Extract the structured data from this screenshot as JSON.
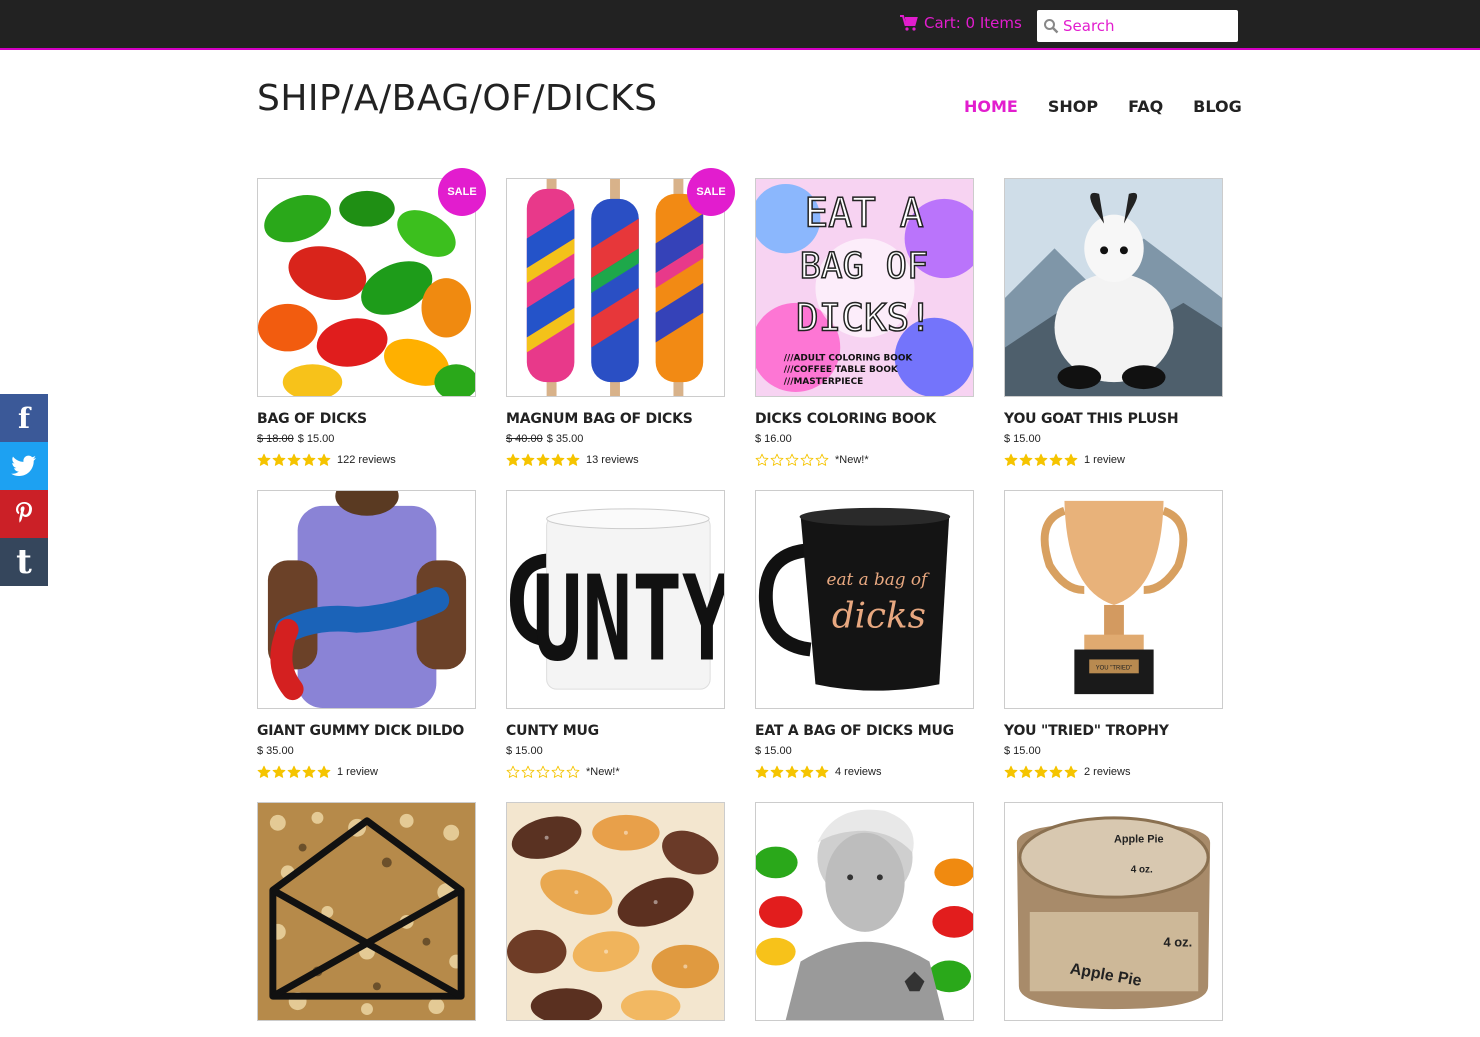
{
  "header": {
    "cart_label": "Cart: 0 Items",
    "search_placeholder": "Search",
    "logo": "SHIP/A/BAG/OF/DICKS",
    "nav": [
      "HOME",
      "SHOP",
      "FAQ",
      "BLOG"
    ],
    "active_nav": "HOME"
  },
  "share": [
    {
      "network": "facebook",
      "icon": "facebook-icon",
      "color": "#3b5998"
    },
    {
      "network": "twitter",
      "icon": "twitter-icon",
      "color": "#1da1f2"
    },
    {
      "network": "pinterest",
      "icon": "pinterest-icon",
      "color": "#cb2027"
    },
    {
      "network": "tumblr",
      "icon": "tumblr-icon",
      "color": "#35465c"
    }
  ],
  "colors": {
    "accent": "#e21dce",
    "topbar": "#222222",
    "star": "#f5c400"
  },
  "products": [
    {
      "name": "BAG OF DICKS",
      "old_price": "$ 18.00",
      "price": "$ 15.00",
      "sale": "SALE",
      "stars": 5,
      "reviews": "122 reviews",
      "image": "gummy-candies"
    },
    {
      "name": "MAGNUM BAG OF DICKS",
      "old_price": "$ 40.00",
      "price": "$ 35.00",
      "sale": "SALE",
      "stars": 5,
      "reviews": "13 reviews",
      "image": "striped-candy-pops"
    },
    {
      "name": "DICKS COLORING BOOK",
      "old_price": "",
      "price": "$ 16.00",
      "sale": "",
      "stars": 0,
      "reviews": "*New!*",
      "image": "coloring-book-cover",
      "image_text": [
        "EAT A",
        "BAG OF",
        "DICKS!",
        "///ADULT COLORING BOOK",
        "///COFFEE TABLE BOOK",
        "///MASTERPIECE"
      ]
    },
    {
      "name": "YOU GOAT THIS PLUSH",
      "old_price": "",
      "price": "$ 15.00",
      "sale": "",
      "stars": 5,
      "reviews": "1 review",
      "image": "goat-plush"
    },
    {
      "name": "GIANT GUMMY DICK DILDO",
      "old_price": "",
      "price": "$ 35.00",
      "sale": "",
      "stars": 5,
      "reviews": "1 review",
      "image": "giant-gummy"
    },
    {
      "name": "CUNTY MUG",
      "old_price": "",
      "price": "$ 15.00",
      "sale": "",
      "stars": 0,
      "reviews": "*New!*",
      "image": "white-mug",
      "image_text": [
        "UNTY"
      ]
    },
    {
      "name": "EAT A BAG OF DICKS MUG",
      "old_price": "",
      "price": "$ 15.00",
      "sale": "",
      "stars": 5,
      "reviews": "4 reviews",
      "image": "black-mug",
      "image_text": [
        "eat a bag of",
        "dicks"
      ]
    },
    {
      "name": "YOU \"TRIED\" TROPHY",
      "old_price": "",
      "price": "$ 15.00",
      "sale": "",
      "stars": 5,
      "reviews": "2 reviews",
      "image": "gold-trophy",
      "image_text": [
        "YOU \"TRIED\""
      ]
    },
    {
      "name": "",
      "old_price": "",
      "price": "",
      "sale": "",
      "stars": null,
      "reviews": "",
      "image": "glitter-envelope"
    },
    {
      "name": "",
      "old_price": "",
      "price": "",
      "sale": "",
      "stars": null,
      "reviews": "",
      "image": "sour-gummies"
    },
    {
      "name": "",
      "old_price": "",
      "price": "",
      "sale": "",
      "stars": null,
      "reviews": "",
      "image": "portrait-with-gummies"
    },
    {
      "name": "",
      "old_price": "",
      "price": "",
      "sale": "",
      "stars": null,
      "reviews": "",
      "image": "candle-tin",
      "image_text": [
        "Apple Pie",
        "4 oz."
      ]
    }
  ]
}
